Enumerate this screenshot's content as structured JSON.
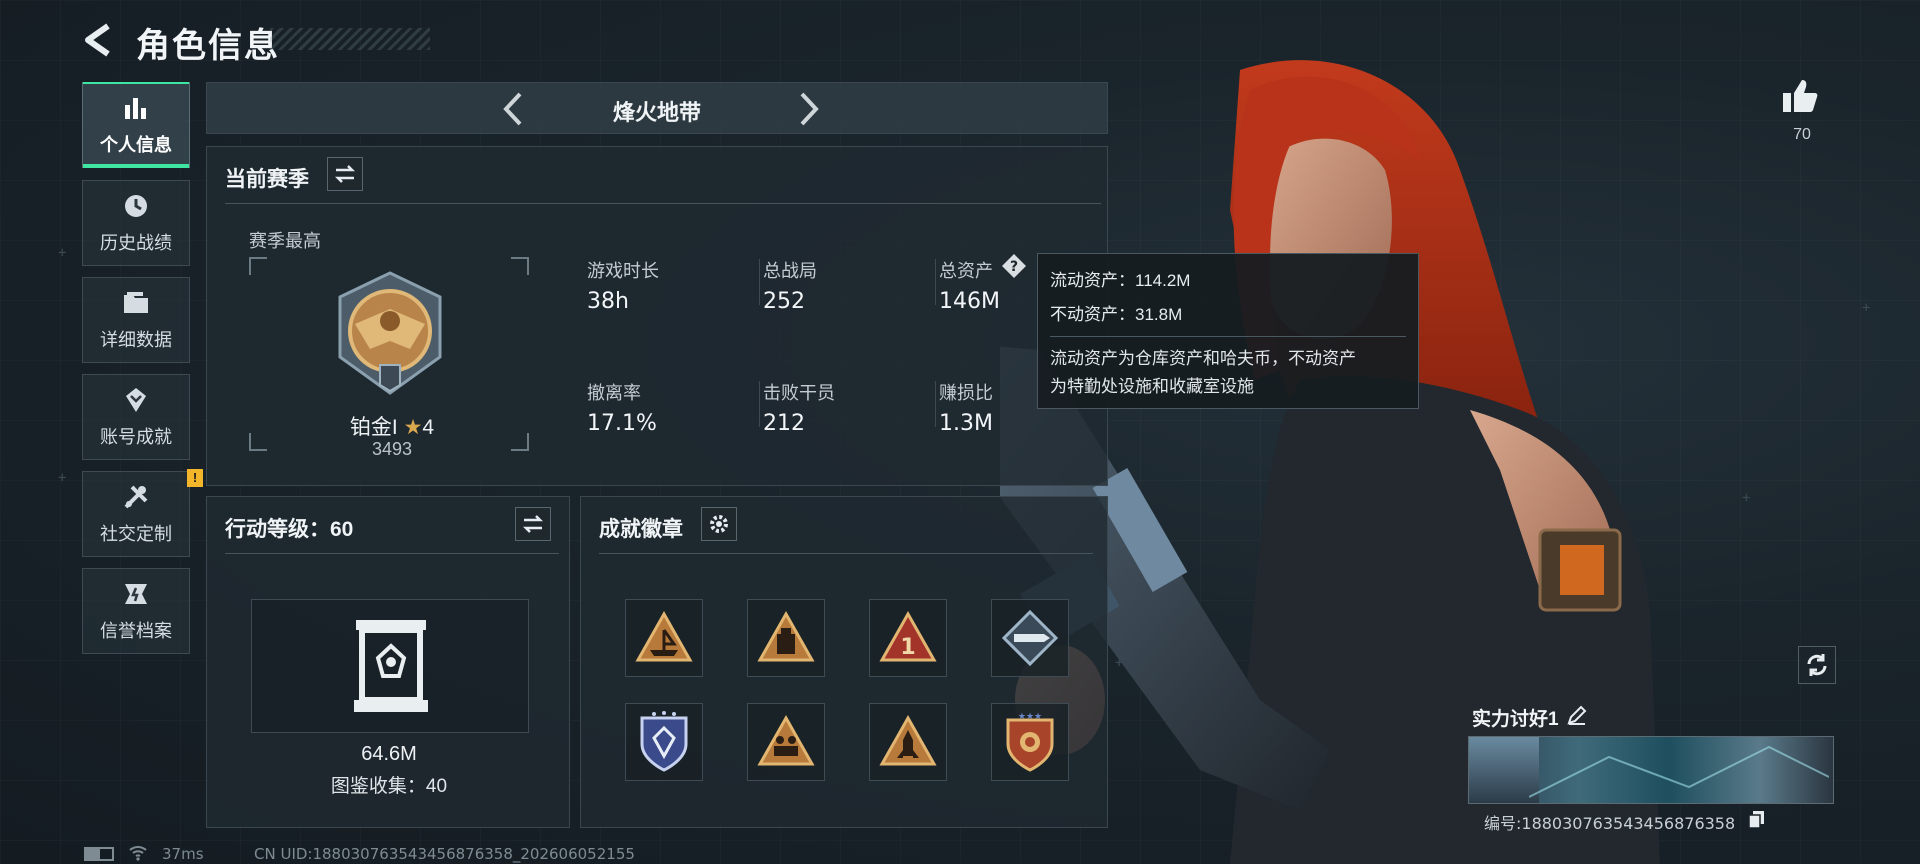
{
  "header": {
    "title": "角色信息"
  },
  "nav": [
    {
      "label": "个人信息",
      "icon": "bar-chart-icon",
      "active": true
    },
    {
      "label": "历史战绩",
      "icon": "history-icon",
      "active": false
    },
    {
      "label": "详细数据",
      "icon": "folder-icon",
      "active": false
    },
    {
      "label": "账号成就",
      "icon": "achievement-icon",
      "active": false
    },
    {
      "label": "社交定制",
      "icon": "tools-icon",
      "active": false,
      "badge": "!"
    },
    {
      "label": "信誉档案",
      "icon": "reputation-icon",
      "active": false
    }
  ],
  "mode": {
    "label": "烽火地带"
  },
  "season": {
    "title": "当前赛季",
    "best_label": "赛季最高",
    "rank_name": "铂金I",
    "rank_stars": "4",
    "rank_points": "3493",
    "stats": [
      {
        "label": "游戏时长",
        "value": "38h"
      },
      {
        "label": "总战局",
        "value": "252"
      },
      {
        "label": "总资产",
        "value": "146M"
      },
      {
        "label": "撤离率",
        "value": "17.1%"
      },
      {
        "label": "击败干员",
        "value": "212"
      },
      {
        "label": "赚损比",
        "value": "1.3M"
      }
    ]
  },
  "tooltip": {
    "liquid": "流动资产：114.2M",
    "fixed": "不动资产：31.8M",
    "desc_line1": "流动资产为仓库资产和哈夫币，不动资产",
    "desc_line2": "为特勤处设施和收藏室设施"
  },
  "level": {
    "title": "行动等级：60",
    "collection_value": "64.6M",
    "collection_label": "图鉴收集：40"
  },
  "achievements": {
    "title": "成就徽章",
    "badges": [
      "boat-badge-icon",
      "bag-badge-icon",
      "number-one-badge-icon",
      "bullet-badge-icon",
      "shield-badge-icon",
      "squad-badge-icon",
      "rocket-badge-icon",
      "star-shield-badge-icon"
    ]
  },
  "profile": {
    "likes": "70",
    "player_name": "实力讨好1",
    "player_id": "编号:18803076354345687635​8"
  },
  "footer": {
    "ping": "37ms",
    "uid": "CN UID:18803076354345687635​8_202606052155"
  },
  "colors": {
    "accent": "#3fe6a2",
    "warning": "#f3b52a",
    "gold": "#c99a4c"
  }
}
